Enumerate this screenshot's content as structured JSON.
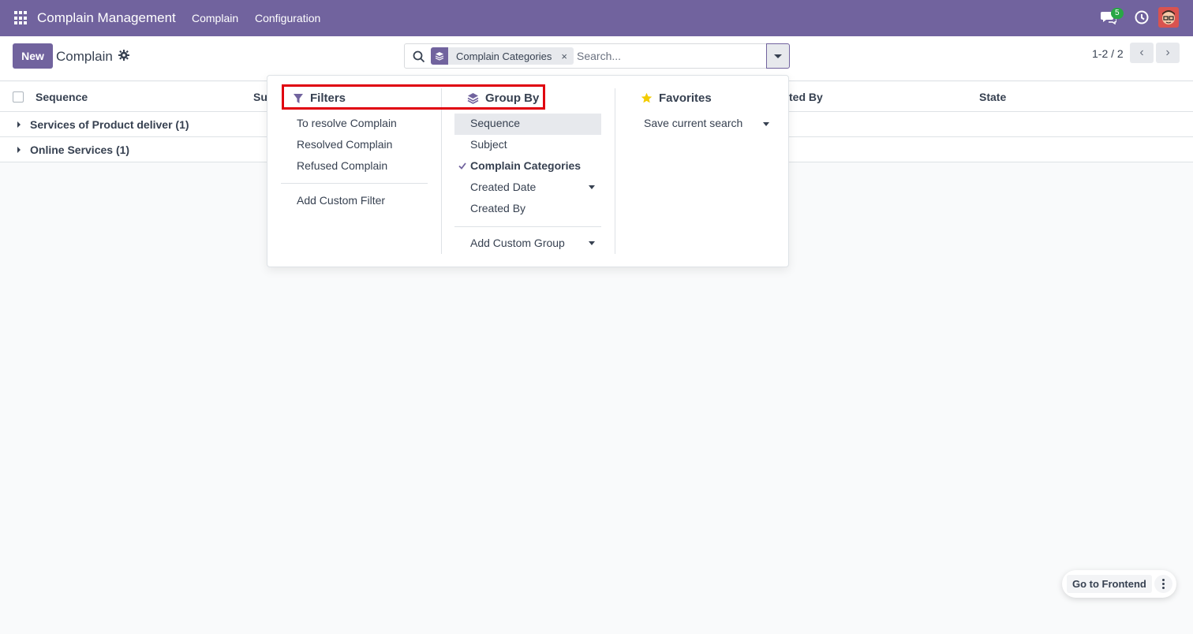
{
  "navbar": {
    "brand": "Complain Management",
    "menus": [
      "Complain",
      "Configuration"
    ],
    "chat_badge": "5",
    "bg_color": "#71639e"
  },
  "control": {
    "new_label": "New",
    "breadcrumb": "Complain",
    "search": {
      "facet_label": "Complain Categories",
      "facet_close": "×",
      "placeholder": "Search..."
    },
    "pager": "1-2 / 2",
    "pager_prev": "‹",
    "pager_next": "›"
  },
  "list": {
    "columns": [
      "Sequence",
      "Su",
      "ted By",
      "State"
    ],
    "groups": [
      {
        "label": "Services of Product deliver (1)"
      },
      {
        "label": "Online Services (1)"
      }
    ]
  },
  "dropdown": {
    "filters": {
      "title": "Filters",
      "items": [
        "To resolve Complain",
        "Resolved Complain",
        "Refused Complain"
      ],
      "custom": "Add Custom Filter"
    },
    "groupby": {
      "title": "Group By",
      "items": [
        "Sequence",
        "Subject",
        "Complain Categories",
        "Created Date",
        "Created By"
      ],
      "checked": "Complain Categories",
      "custom": "Add Custom Group"
    },
    "favorites": {
      "title": "Favorites",
      "items": [
        "Save current search"
      ]
    }
  },
  "floating": {
    "go_frontend": "Go to Frontend"
  },
  "highlight_color": "#e0000f"
}
